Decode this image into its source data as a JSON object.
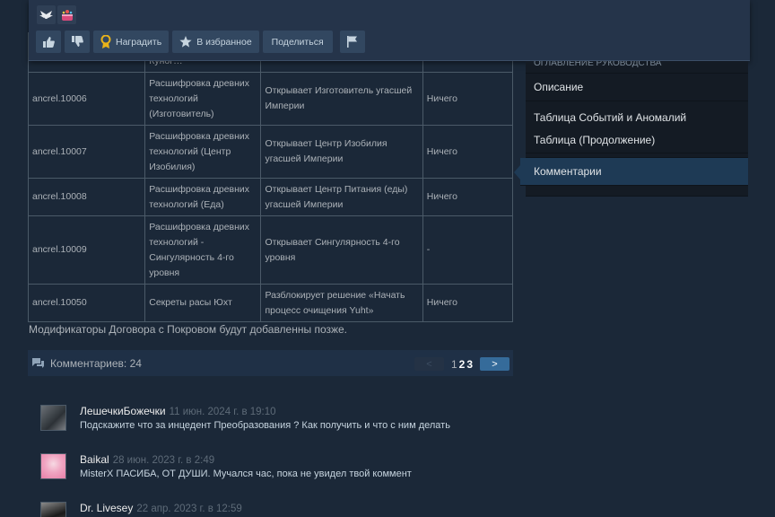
{
  "table": {
    "rows": [
      {
        "id": "",
        "name": "Куног…",
        "effect": "",
        "cost": ""
      },
      {
        "id": "ancrel.10006",
        "name": "Расшифровка древних технологий (Изготовитель)",
        "effect": "Открывает Изготовитель угасшей Империи",
        "cost": "Ничего"
      },
      {
        "id": "ancrel.10007",
        "name": "Расшифровка древних технологий (Центр Изобилия)",
        "effect": "Открывает Центр Изобилия угасшей Империи",
        "cost": "Ничего"
      },
      {
        "id": "ancrel.10008",
        "name": "Расшифровка древних технологий (Еда)",
        "effect": "Открывает Центр Питания (еды) угасшей Империи",
        "cost": "Ничего"
      },
      {
        "id": "ancrel.10009",
        "name": "Расшифровка древних технологий - Сингулярность 4-го уровня",
        "effect": "Открывает Сингулярность 4-го уровня",
        "cost": "-"
      },
      {
        "id": "ancrel.10050",
        "name": "Секреты расы Юхт",
        "effect": "Разблокирует решение «Начать процесс очищения Yuht»",
        "cost": "Ничего"
      }
    ]
  },
  "footnote": "Модификаторы Договора с Покровом будут добавленны позже.",
  "actions": {
    "award_label": "Наградить",
    "favorite_label": "В избранное",
    "share_label": "Поделиться"
  },
  "sidebar": {
    "cut_item": "ОГЛАВЛЕНИЕ РУКОВОДСТВА",
    "items": [
      {
        "label": "Описание"
      },
      {
        "label": "Таблица Событий и Аномалий"
      },
      {
        "label": "Таблица (Продолжение)"
      },
      {
        "label": "Комментарии"
      }
    ]
  },
  "comments_header": {
    "count_text": "Комментариев: 24",
    "pages": [
      "1",
      "2",
      "3"
    ],
    "prev": "<",
    "next": ">"
  },
  "comments": [
    {
      "author": "ЛешечкиБожечки",
      "time": "11 июн. 2024 г. в 19:10",
      "text": "Подскажите что за инцедент Преобразования ? Как получить и что с ним делать"
    },
    {
      "author": "Baikal",
      "time": "28 июн. 2023 г. в 2:49",
      "text": "MisterX ПАСИБА, ОТ ДУШИ. Мучался час, пока не увидел твой коммент"
    },
    {
      "author": "Dr. Livesey",
      "time": "22 апр. 2023 г. в 12:59",
      "text": ""
    }
  ],
  "colors": {
    "accent": "#356b9a",
    "background": "#1b2838"
  }
}
